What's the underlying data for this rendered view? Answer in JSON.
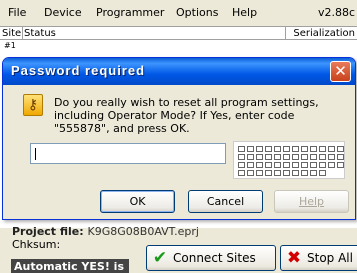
{
  "menu": {
    "file": "File",
    "device": "Device",
    "programmer": "Programmer",
    "options": "Options",
    "help": "Help",
    "version": "v2.88c"
  },
  "table": {
    "col_site": "Site",
    "col_status": "Status",
    "col_serialization": "Serialization",
    "row1_site": "#1"
  },
  "project": {
    "label": "Project file:",
    "value": "K9G8G08B0AVT.eprj"
  },
  "chksum": {
    "label": "Chksum:"
  },
  "badge": {
    "label": "Automatic YES! is On"
  },
  "buttons": {
    "connect_sites": "Connect Sites",
    "stop_all": "Stop All"
  },
  "dialog": {
    "title": "Password required",
    "message": "Do you really wish to reset all program settings, including Operator Mode? If Yes, enter code \"555878\", and press OK.",
    "password_value": "",
    "ok": "OK",
    "cancel": "Cancel",
    "help": "Help",
    "close_glyph": "✕"
  },
  "icons": {
    "key": "key-icon",
    "check": "check-icon",
    "stop": "stop-x-icon",
    "keypad": "on-screen-keyboard-icon"
  },
  "colors": {
    "titlebar": "#0058e6",
    "close": "#c9421c",
    "check_green": "#1a9a1a",
    "stop_red": "#d40000"
  }
}
